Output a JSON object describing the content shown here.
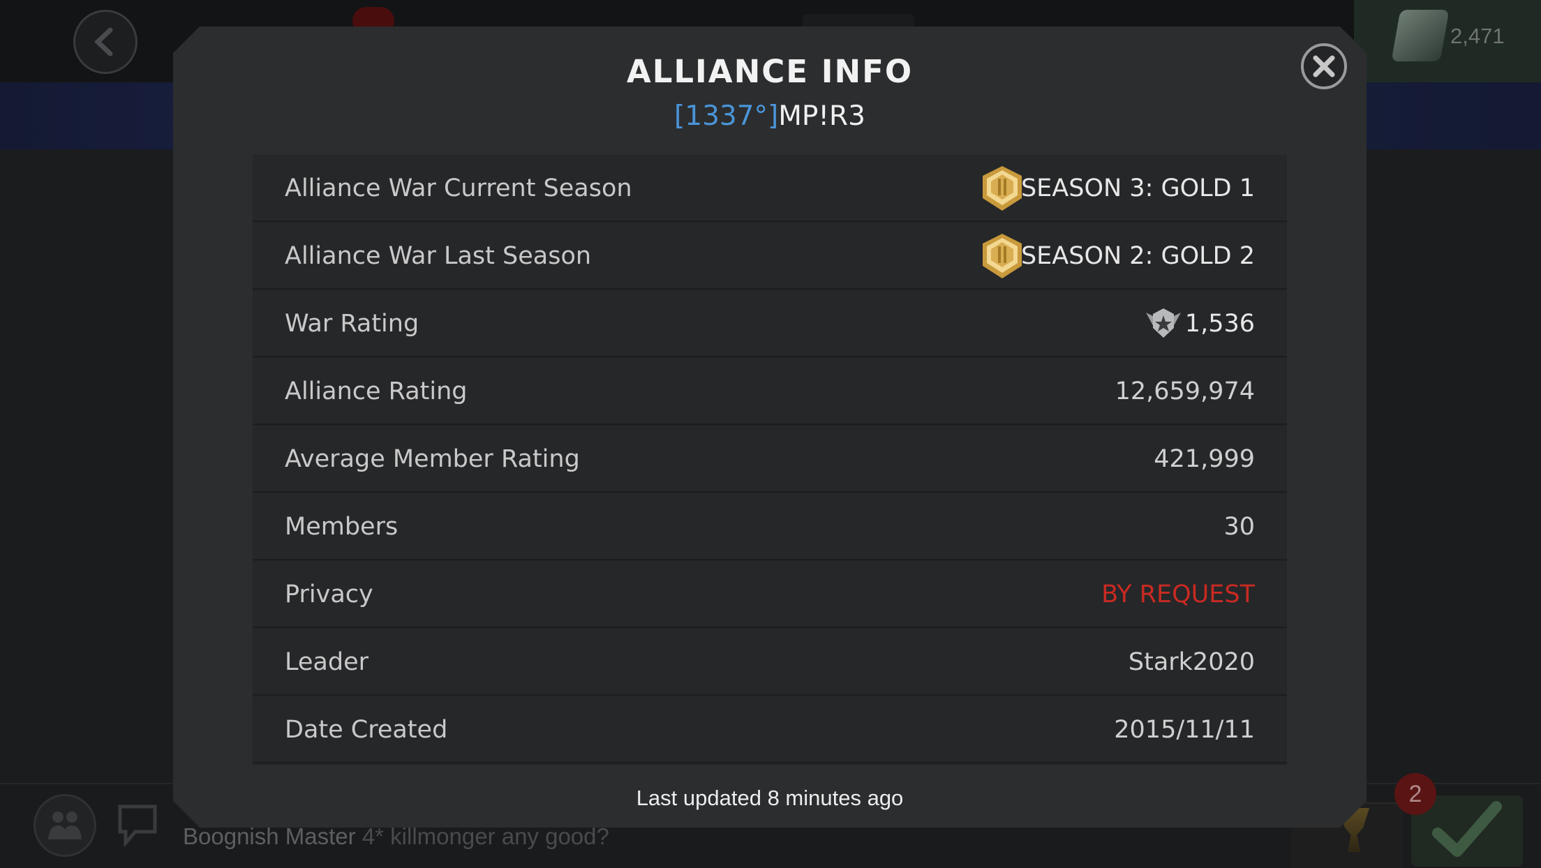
{
  "background": {
    "currency_value": "2,471",
    "chat_author": "Boognish Master",
    "chat_message": "4* killmonger any good?",
    "notification_count": "2"
  },
  "modal": {
    "title": "ALLIANCE INFO",
    "alliance_tag": "[1337°]",
    "alliance_name": "MP!R3",
    "rows": [
      {
        "label": "Alliance War Current Season",
        "value": "SEASON 3: GOLD 1"
      },
      {
        "label": "Alliance War Last Season",
        "value": "SEASON 2: GOLD 2"
      },
      {
        "label": "War Rating",
        "value": "1,536"
      },
      {
        "label": "Alliance Rating",
        "value": "12,659,974"
      },
      {
        "label": "Average Member Rating",
        "value": "421,999"
      },
      {
        "label": "Members",
        "value": "30"
      },
      {
        "label": "Privacy",
        "value": "BY REQUEST"
      },
      {
        "label": "Leader",
        "value": "Stark2020"
      },
      {
        "label": "Date Created",
        "value": "2015/11/11"
      }
    ],
    "footer": "Last updated 8 minutes ago"
  },
  "colors": {
    "tag_blue": "#4a95d8",
    "privacy_red": "#c92a22",
    "gold_medal": "#d9b35a"
  }
}
